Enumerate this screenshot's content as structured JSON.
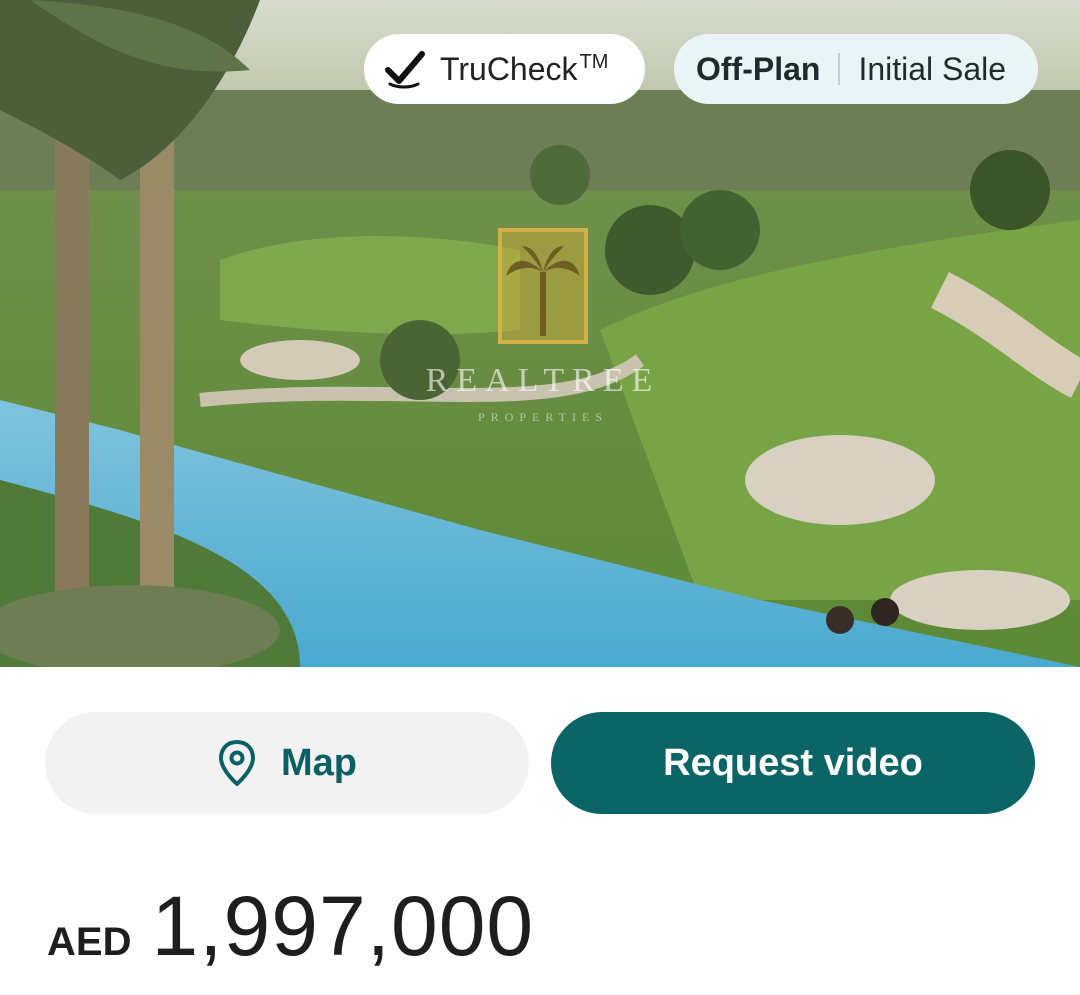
{
  "hero": {
    "badges": {
      "trucheck_label": "TruCheck",
      "trucheck_tm": "TM",
      "status_primary": "Off-Plan",
      "status_secondary": "Initial Sale"
    },
    "watermark": {
      "title": "REALTREE",
      "subtitle": "PROPERTIES"
    }
  },
  "actions": {
    "map_label": "Map",
    "video_label": "Request video"
  },
  "price": {
    "currency": "AED",
    "amount": "1,997,000"
  },
  "colors": {
    "brand_teal": "#0b6466",
    "map_button_bg": "#f2f2f2",
    "status_badge_bg": "#eaf4f6"
  },
  "icons": {
    "check": "check-icon",
    "map_pin": "map-pin-icon"
  }
}
